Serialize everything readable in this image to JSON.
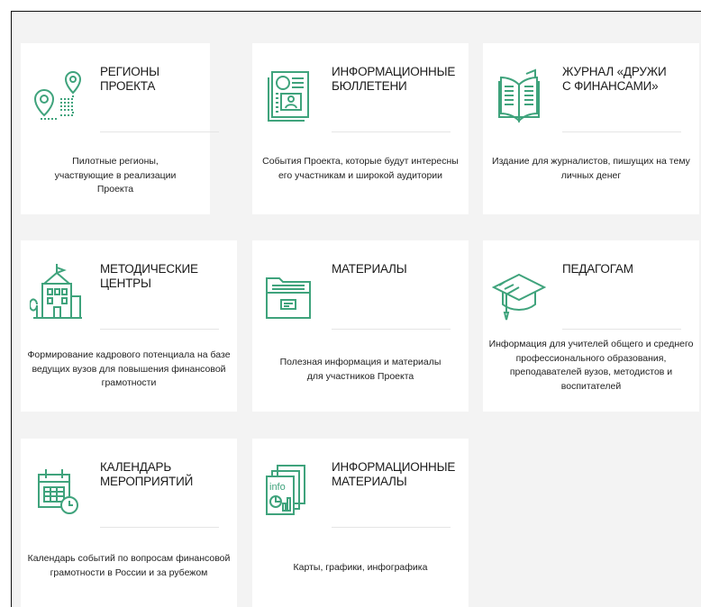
{
  "cards": [
    {
      "title": "РЕГИОНЫ ПРОЕКТА",
      "desc": "Пилотные регионы, участвующие в реализации Проекта",
      "icon": "map-route-icon"
    },
    {
      "title": "ИНФОРМАЦИОННЫЕ БЮЛЛЕТЕНИ",
      "desc": "События Проекта, которые будут интересны его участникам и широкой аудитории",
      "icon": "bulletin-icon"
    },
    {
      "title": "ЖУРНАЛ «ДРУЖИ С ФИНАНСАМИ»",
      "desc": "Издание для журналистов, пишущих на тему личных денег",
      "icon": "open-book-icon"
    },
    {
      "title": "МЕТОДИЧЕСКИЕ ЦЕНТРЫ",
      "desc": "Формирование кадрового потенциала на базе ведущих вузов для повышения финансовой грамотности",
      "icon": "building-icon"
    },
    {
      "title": "МАТЕРИАЛЫ",
      "desc": "Полезная информация и материалы для участников Проекта",
      "icon": "folder-icon"
    },
    {
      "title": "ПЕДАГОГАМ",
      "desc": "Информация для учителей общего и среднего профессионального образования, преподавателей вузов, методистов и воспитателей",
      "icon": "graduation-cap-icon"
    },
    {
      "title": "КАЛЕНДАРЬ МЕРОПРИЯТИЙ",
      "desc": "Календарь событий по вопросам финансовой грамотности в России и за рубежом",
      "icon": "calendar-icon"
    },
    {
      "title": "ИНФОРМАЦИОННЫЕ МАТЕРИАЛЫ",
      "desc": "Карты, графики, инфографика",
      "icon": "infographic-icon",
      "icon_text": "info"
    }
  ],
  "colors": {
    "accent": "#3fa37c",
    "card_bg": "#ffffff",
    "page_bg": "#f3f3f3"
  }
}
